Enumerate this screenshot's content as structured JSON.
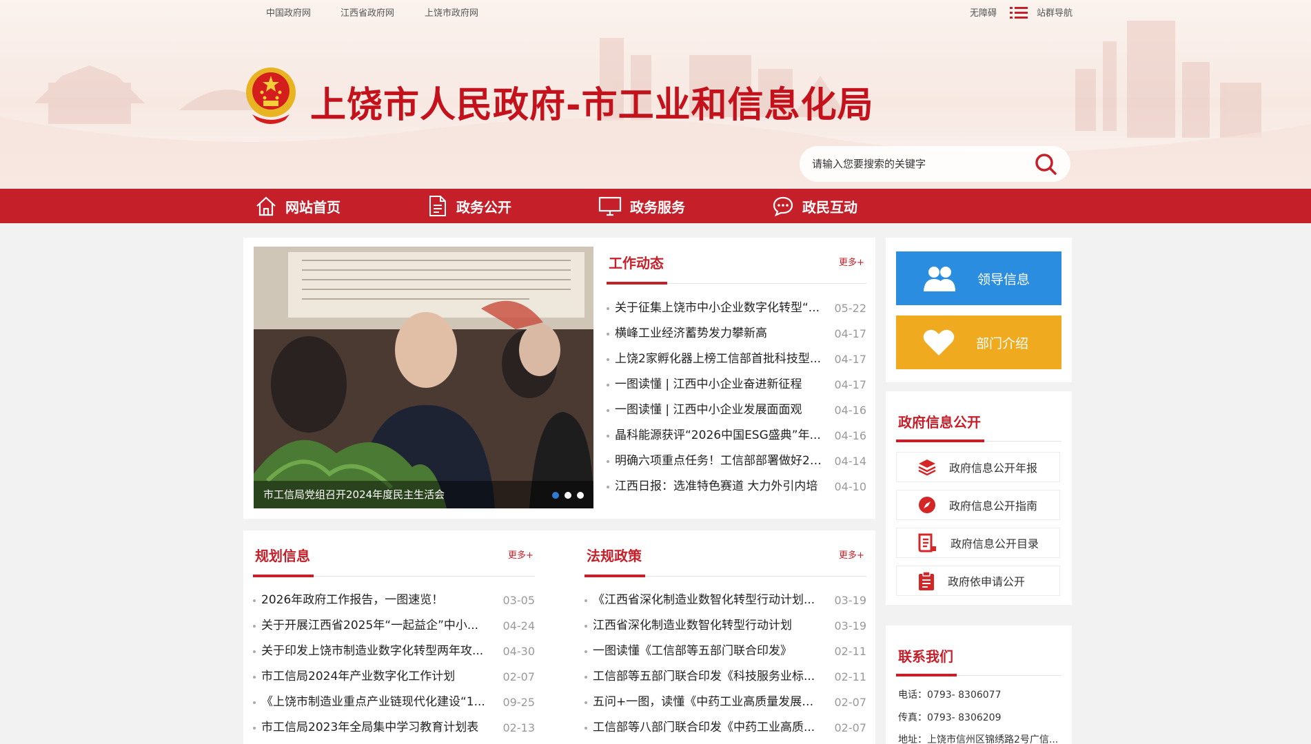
{
  "top_links": [
    "中国政府网",
    "江西省政府网",
    "上饶市政府网"
  ],
  "top_right": {
    "accessibility": "无障碍",
    "site_nav": "站群导航"
  },
  "site_title": "上饶市人民政府-市工业和信息化局",
  "search": {
    "placeholder": "请输入您要搜索的关键字"
  },
  "nav": [
    {
      "label": "网站首页",
      "icon": "home-icon"
    },
    {
      "label": "政务公开",
      "icon": "document-icon"
    },
    {
      "label": "政务服务",
      "icon": "monitor-icon"
    },
    {
      "label": "政民互动",
      "icon": "chat-icon"
    }
  ],
  "carousel": {
    "caption": "市工信局党组召开2024年度民主生活会",
    "slide_count": 3,
    "active_slide": 1
  },
  "work_news": {
    "title": "工作动态",
    "more": "更多+",
    "items": [
      {
        "title": "关于征集上饶市中小企业数字化转型“...",
        "date": "05-22"
      },
      {
        "title": "横峰工业经济蓄势发力攀新高",
        "date": "04-17"
      },
      {
        "title": "上饶2家孵化器上榜工信部首批科技型...",
        "date": "04-17"
      },
      {
        "title": "一图读懂 | 江西中小企业奋进新征程",
        "date": "04-17"
      },
      {
        "title": "一图读懂 | 江西中小企业发展面面观",
        "date": "04-16"
      },
      {
        "title": "晶科能源获评“2026中国ESG盛典”年...",
        "date": "04-16"
      },
      {
        "title": "明确六项重点任务！工信部部署做好20...",
        "date": "04-14"
      },
      {
        "title": "江西日报：选准特色赛道 大力外引内培",
        "date": "04-10"
      }
    ]
  },
  "planning": {
    "title": "规划信息",
    "more": "更多+",
    "items": [
      {
        "title": "2026年政府工作报告，一图速览！",
        "date": "03-05"
      },
      {
        "title": "关于开展江西省2025年“一起益企”中小...",
        "date": "04-24"
      },
      {
        "title": "关于印发上饶市制造业数字化转型两年攻...",
        "date": "04-30"
      },
      {
        "title": "市工信局2024年产业数字化工作计划",
        "date": "02-07"
      },
      {
        "title": "《上饶市制造业重点产业链现代化建设“1...",
        "date": "09-25"
      },
      {
        "title": "市工信局2023年全局集中学习教育计划表",
        "date": "02-13"
      }
    ]
  },
  "policy": {
    "title": "法规政策",
    "more": "更多+",
    "items": [
      {
        "title": "《江西省深化制造业数智化转型行动计划...",
        "date": "03-19"
      },
      {
        "title": "江西省深化制造业数智化转型行动计划",
        "date": "03-19"
      },
      {
        "title": "一图读懂《工信部等五部门联合印发》",
        "date": "02-11"
      },
      {
        "title": "工信部等五部门联合印发《科技服务业标...",
        "date": "02-11"
      },
      {
        "title": "五问+一图，读懂《中药工业高质量发展实...",
        "date": "02-07"
      },
      {
        "title": "工信部等八部门联合印发《中药工业高质...",
        "date": "02-07"
      }
    ]
  },
  "quick_buttons": [
    {
      "label": "领导信息",
      "color": "#2a8ddf",
      "icon": "leaders-icon"
    },
    {
      "label": "部门介绍",
      "color": "#f0aa1f",
      "icon": "heart-icon"
    }
  ],
  "gov_info": {
    "title": "政府信息公开",
    "items": [
      {
        "label": "政府信息公开年报",
        "icon": "layers-icon"
      },
      {
        "label": "政府信息公开指南",
        "icon": "compass-icon"
      },
      {
        "label": "政府信息公开目录",
        "icon": "catalog-icon"
      },
      {
        "label": "政府依申请公开",
        "icon": "clipboard-icon"
      }
    ]
  },
  "contact": {
    "title": "联系我们",
    "phone": "电话：0793- 8306077",
    "fax": "传真：0793- 8306209",
    "address": "地址：上饶市信州区锦绣路2号广信..."
  },
  "colors": {
    "brand_red": "#c5202a",
    "title_red": "#c4121c",
    "blue": "#2a8ddf",
    "orange": "#f0aa1f"
  }
}
